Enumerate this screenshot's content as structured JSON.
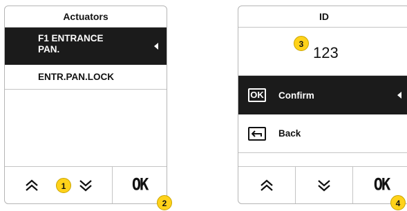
{
  "left_screen": {
    "title": "Actuators",
    "items": [
      {
        "label": "F1 ENTRANCE PAN.",
        "selected": true
      },
      {
        "label": "ENTR.PAN.LOCK",
        "selected": false
      }
    ],
    "ok_label": "OK",
    "badges": {
      "nav": "1",
      "ok": "2"
    }
  },
  "right_screen": {
    "title": "ID",
    "id_value": "123",
    "confirm_label": "Confirm",
    "confirm_icon_text": "OK",
    "back_label": "Back",
    "ok_label": "OK",
    "badges": {
      "value": "3",
      "ok": "4"
    }
  },
  "colors": {
    "badge": "#ffd21a",
    "selected_bg": "#1b1b1b"
  },
  "icons": [
    "chevron-double-up-icon",
    "chevron-double-down-icon",
    "caret-left-icon",
    "back-arrow-icon"
  ]
}
